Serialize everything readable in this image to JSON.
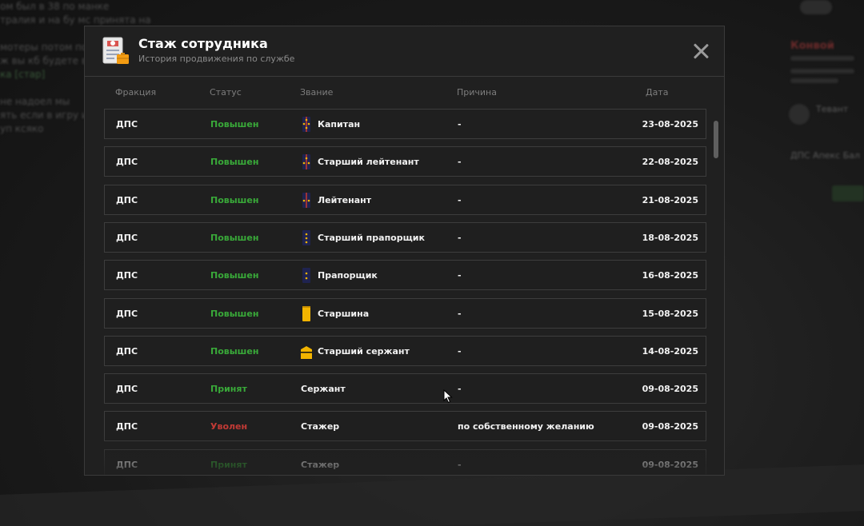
{
  "background": {
    "left_text": [
      "ом был в 38 по манке",
      "тралия и на бу мс принята на",
      "",
      "мотеры потом пол",
      "ж вы кб будете в",
      "ка [стар]",
      "",
      "не надоел мы",
      "ять если в игру и",
      "уп ксяко"
    ],
    "right": {
      "name": "Конвой",
      "item": "Тевант",
      "sub": "ДПС Апекс Бал"
    }
  },
  "modal": {
    "title": "Стаж сотрудника",
    "subtitle": "История продвижения по службе",
    "icon": "document-badge-icon",
    "close_icon": "close-icon",
    "columns": {
      "faction": "Фракция",
      "status": "Статус",
      "rank": "Звание",
      "reason": "Причина",
      "date": "Дата"
    },
    "rows": [
      {
        "faction": "ДПС",
        "status": "Повышен",
        "status_kind": "up",
        "rank": "Капитан",
        "rank_icon": "epaulette-captain-icon",
        "reason": "-",
        "date": "23-08-2025"
      },
      {
        "faction": "ДПС",
        "status": "Повышен",
        "status_kind": "up",
        "rank": "Старший лейтенант",
        "rank_icon": "epaulette-senior-lieutenant-icon",
        "reason": "-",
        "date": "22-08-2025"
      },
      {
        "faction": "ДПС",
        "status": "Повышен",
        "status_kind": "up",
        "rank": "Лейтенант",
        "rank_icon": "epaulette-lieutenant-icon",
        "reason": "-",
        "date": "21-08-2025"
      },
      {
        "faction": "ДПС",
        "status": "Повышен",
        "status_kind": "up",
        "rank": "Старший прапорщик",
        "rank_icon": "epaulette-senior-warrant-icon",
        "reason": "-",
        "date": "18-08-2025"
      },
      {
        "faction": "ДПС",
        "status": "Повышен",
        "status_kind": "up",
        "rank": "Прапорщик",
        "rank_icon": "epaulette-warrant-icon",
        "reason": "-",
        "date": "16-08-2025"
      },
      {
        "faction": "ДПС",
        "status": "Повышен",
        "status_kind": "up",
        "rank": "Старшина",
        "rank_icon": "epaulette-starshina-icon",
        "reason": "-",
        "date": "15-08-2025"
      },
      {
        "faction": "ДПС",
        "status": "Повышен",
        "status_kind": "up",
        "rank": "Старший сержант",
        "rank_icon": "epaulette-senior-sergeant-icon",
        "reason": "-",
        "date": "14-08-2025"
      },
      {
        "faction": "ДПС",
        "status": "Принят",
        "status_kind": "hired",
        "rank": "Сержант",
        "rank_icon": "",
        "reason": "-",
        "date": "09-08-2025"
      },
      {
        "faction": "ДПС",
        "status": "Уволен",
        "status_kind": "fired",
        "rank": "Стажер",
        "rank_icon": "",
        "reason": "по собственному желанию",
        "date": "09-08-2025"
      },
      {
        "faction": "ДПС",
        "status": "Принят",
        "status_kind": "hired",
        "rank": "Стажер",
        "rank_icon": "",
        "reason": "-",
        "date": "09-08-2025"
      }
    ]
  },
  "colors": {
    "up": "#39a939",
    "hired": "#39a939",
    "fired": "#c23a35",
    "epaulette_dark": "#1f2350",
    "star_gold": "#f2b400",
    "stripe_red": "#d43a2a"
  }
}
